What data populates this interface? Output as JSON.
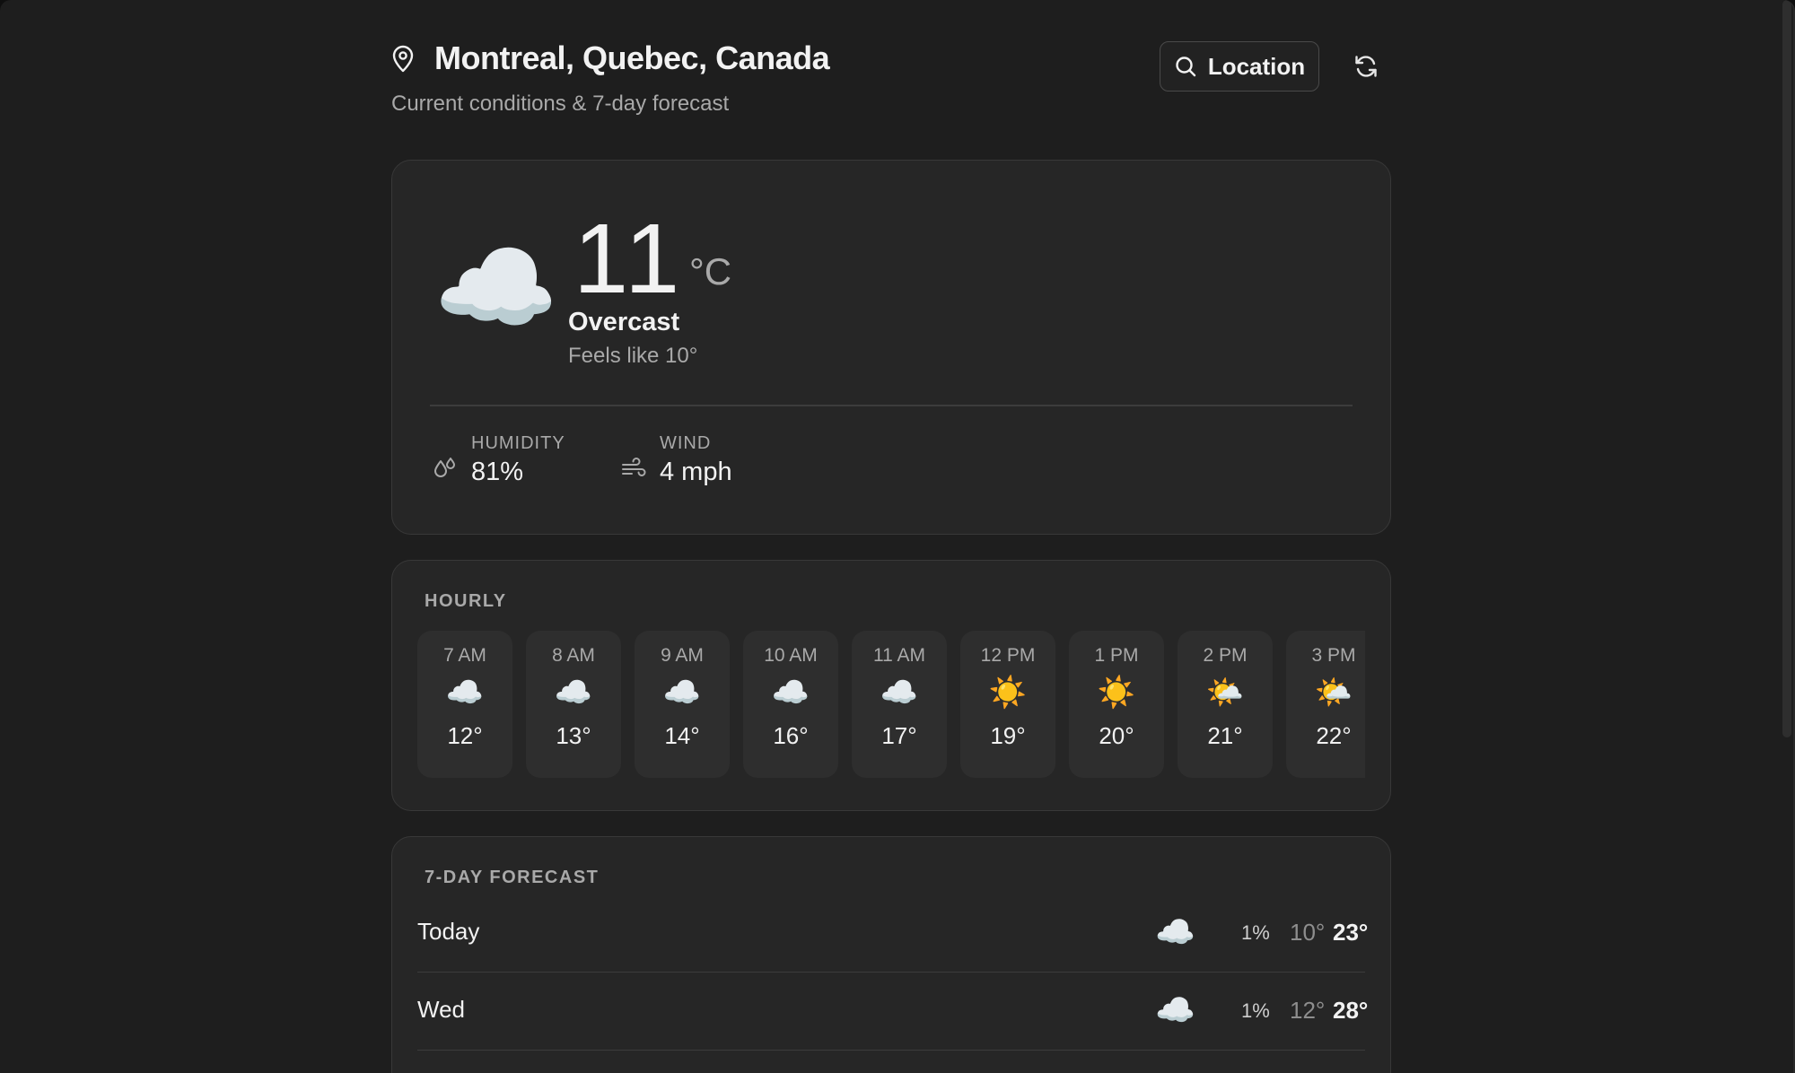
{
  "header": {
    "title": "Montreal, Quebec, Canada",
    "subtitle": "Current conditions & 7-day forecast",
    "location_button": "Location",
    "icons": {
      "pin": "map-pin-icon",
      "search": "search-icon",
      "refresh": "refresh-icon"
    }
  },
  "current": {
    "temp": "11",
    "unit": "°C",
    "condition": "Overcast",
    "feels_like": "Feels like 10°",
    "icon": "☁️",
    "humidity": {
      "label": "HUMIDITY",
      "value": "81%"
    },
    "wind": {
      "label": "WIND",
      "value": "4 mph"
    }
  },
  "hourly": {
    "label": "HOURLY",
    "items": [
      {
        "time": "7 AM",
        "icon": "☁️",
        "temp": "12°"
      },
      {
        "time": "8 AM",
        "icon": "☁️",
        "temp": "13°"
      },
      {
        "time": "9 AM",
        "icon": "☁️",
        "temp": "14°"
      },
      {
        "time": "10 AM",
        "icon": "☁️",
        "temp": "16°"
      },
      {
        "time": "11 AM",
        "icon": "☁️",
        "temp": "17°"
      },
      {
        "time": "12 PM",
        "icon": "☀️",
        "temp": "19°"
      },
      {
        "time": "1 PM",
        "icon": "☀️",
        "temp": "20°"
      },
      {
        "time": "2 PM",
        "icon": "🌤️",
        "temp": "21°"
      },
      {
        "time": "3 PM",
        "icon": "🌤️",
        "temp": "22°"
      }
    ]
  },
  "daily": {
    "label": "7-DAY FORECAST",
    "items": [
      {
        "day": "Today",
        "icon": "☁️",
        "precip": "1%",
        "low": "10°",
        "high": "23°"
      },
      {
        "day": "Wed",
        "icon": "☁️",
        "precip": "1%",
        "low": "12°",
        "high": "28°"
      }
    ]
  }
}
